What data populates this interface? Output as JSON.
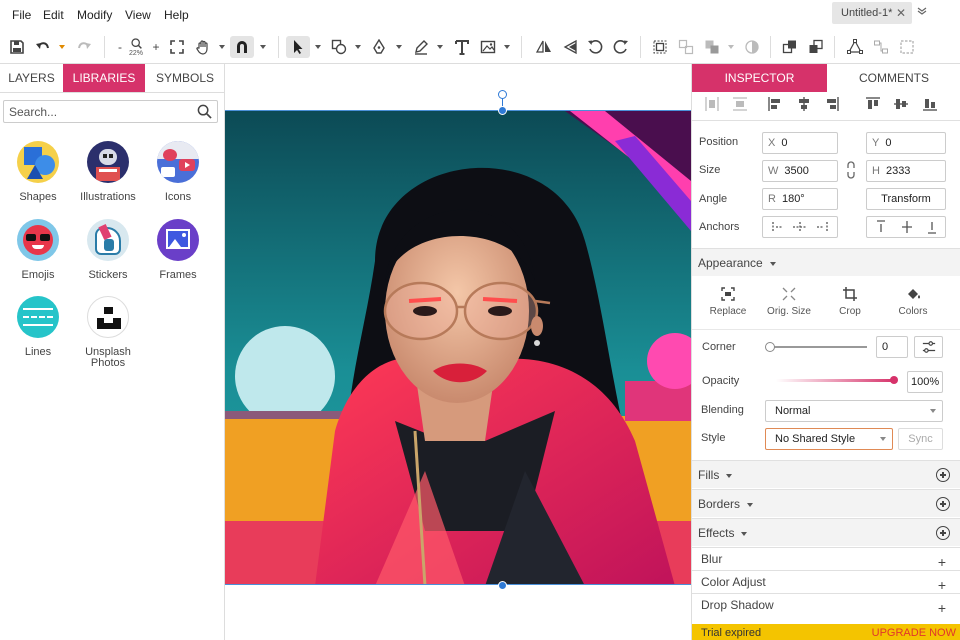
{
  "menu": [
    "File",
    "Edit",
    "Modify",
    "View",
    "Help"
  ],
  "document_tab": {
    "title": "Untitled-1*"
  },
  "toolbar": {
    "zoom": "22%"
  },
  "left_panel": {
    "tabs": [
      "LAYERS",
      "LIBRARIES",
      "SYMBOLS"
    ],
    "active_tab": "LIBRARIES",
    "search_placeholder": "Search...",
    "libraries": [
      "Shapes",
      "Illustrations",
      "Icons",
      "Emojis",
      "Stickers",
      "Frames",
      "Lines",
      "Unsplash Photos"
    ]
  },
  "inspector": {
    "tabs": [
      "INSPECTOR",
      "COMMENTS"
    ],
    "active_tab": "INSPECTOR",
    "position": {
      "label": "Position",
      "x_key": "X",
      "x": "0",
      "y_key": "Y",
      "y": "0"
    },
    "size": {
      "label": "Size",
      "w_key": "W",
      "w": "3500",
      "h_key": "H",
      "h": "2333"
    },
    "angle": {
      "label": "Angle",
      "r_key": "R",
      "r": "180°",
      "transform_button": "Transform"
    },
    "anchors_label": "Anchors",
    "appearance": {
      "header": "Appearance",
      "actions": [
        "Replace",
        "Orig. Size",
        "Crop",
        "Colors"
      ],
      "corner_label": "Corner",
      "corner_value": "0",
      "corner_slider_level": 0,
      "opacity_label": "Opacity",
      "opacity_value": "100%",
      "opacity_level": 1.0,
      "blending_label": "Blending",
      "blending_value": "Normal",
      "style_label": "Style",
      "style_value": "No Shared Style",
      "sync_button": "Sync"
    },
    "sections": [
      "Fills",
      "Borders",
      "Effects"
    ],
    "effects": [
      "Blur",
      "Color Adjust",
      "Drop Shadow"
    ]
  },
  "trial": {
    "message": "Trial expired",
    "upgrade": "UPGRADE NOW"
  },
  "colors": {
    "accent": "#d6326a",
    "selection": "#2f7ad6",
    "trial_bar": "#f4c400",
    "upgrade_text": "#e0352b"
  }
}
